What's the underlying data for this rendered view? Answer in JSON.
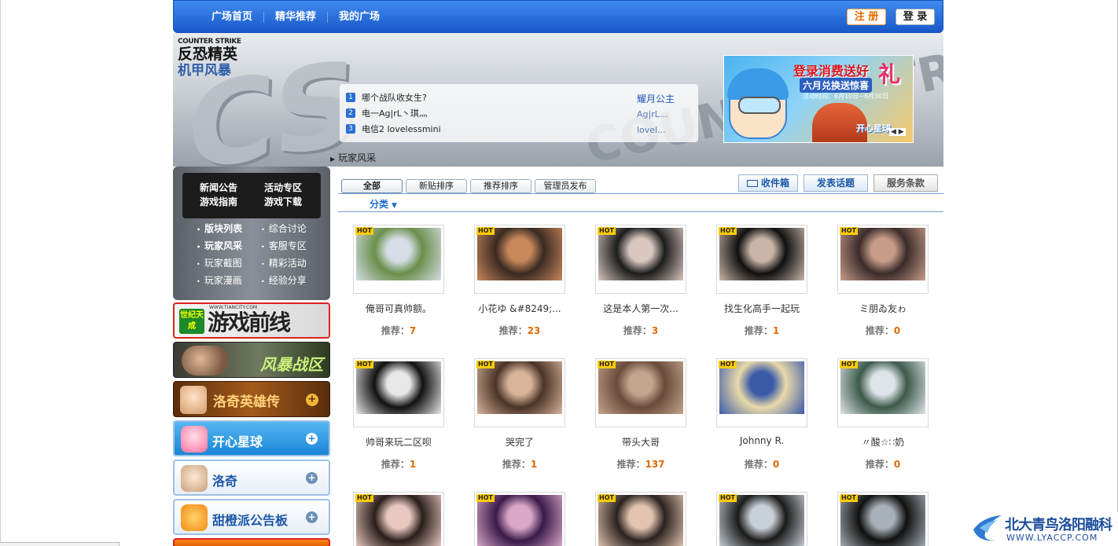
{
  "topnav": {
    "links": [
      "广场首页",
      "精华推荐",
      "我的广场"
    ],
    "register": "注 册",
    "login": "登 录"
  },
  "banner": {
    "bg_text": "CS",
    "bg_text2": "COUNTER-STRIKE",
    "logo_en": "COUNTER STRIKE",
    "logo_cn": "反恐精英",
    "logo_sub": "机甲风暴",
    "notices": [
      {
        "num": "1",
        "text": "哪个战队收女生?"
      },
      {
        "num": "2",
        "text": "电一Ag|rL丶琪灬"
      },
      {
        "num": "3",
        "text": "电信2 lovelessmini"
      }
    ],
    "notice_right": [
      "耀月公主",
      "Ag|rL...",
      "lovel..."
    ],
    "ad": {
      "title": "登录消费送好",
      "li": "礼",
      "sub": "六月兑换送惊喜",
      "date": "活动时间：6月10日~6月30日",
      "brand": "开心星球"
    },
    "crumb": "玩家风采"
  },
  "sidebar": {
    "top_menu": [
      "新闻公告",
      "活动专区",
      "游戏指南",
      "游戏下载"
    ],
    "menu": [
      {
        "label": "版块列表",
        "bold": true
      },
      {
        "label": "综合讨论",
        "bold": false
      },
      {
        "label": "玩家风采",
        "bold": true
      },
      {
        "label": "客服专区",
        "bold": false
      },
      {
        "label": "玩家截图",
        "bold": false
      },
      {
        "label": "精彩活动",
        "bold": false
      },
      {
        "label": "玩家漫画",
        "bold": false
      },
      {
        "label": "经验分享",
        "bold": false
      }
    ],
    "banners": {
      "b1": "游戏前线",
      "b1_badge": "世纪天成",
      "b1_url": "WWW.TIANCITY.COM",
      "b2": "风暴战区",
      "b3": "洛奇英雄传",
      "b4": "开心星球",
      "b5": "洛奇",
      "b6": "甜橙派公告板",
      "plus": "+"
    }
  },
  "main": {
    "tabs": [
      "全部",
      "新贴排序",
      "推荐排序",
      "管理员发布"
    ],
    "actions": {
      "inbox": "收件箱",
      "post": "发表话题",
      "terms": "服务条款"
    },
    "category": "分类",
    "hot_label": "HOT",
    "rec_label": "推荐：",
    "cards": [
      {
        "caption": "俺哥可真帅额。",
        "rec": "7",
        "c1": "#6a8f4a",
        "c2": "#d6dde6"
      },
      {
        "caption": "小花ゆ &#8249;...",
        "rec": "23",
        "c1": "#3a2a22",
        "c2": "#c9885a"
      },
      {
        "caption": "这是本人第一次...",
        "rec": "3",
        "c1": "#1c1c1c",
        "c2": "#d9c8c0"
      },
      {
        "caption": "找生化高手一起玩",
        "rec": "1",
        "c1": "#101010",
        "c2": "#c9b6a8"
      },
      {
        "caption": "ミ朋ゐ友ゎ",
        "rec": "0",
        "c1": "#3b2c2a",
        "c2": "#c79d8a"
      },
      {
        "caption": "帅哥来玩二区呗",
        "rec": "1",
        "c1": "#111111",
        "c2": "#e8e8e8"
      },
      {
        "caption": "哭完了",
        "rec": "1",
        "c1": "#4a3428",
        "c2": "#d8b49a"
      },
      {
        "caption": "带头大哥",
        "rec": "137",
        "c1": "#6a4a3a",
        "c2": "#c3a58e"
      },
      {
        "caption": "Johnny R.",
        "rec": "0",
        "c1": "#e9d9a8",
        "c2": "#3a5aa8"
      },
      {
        "caption": "〃酸☆∷奶",
        "rec": "0",
        "c1": "#3c5a4a",
        "c2": "#dfe4ea"
      },
      {
        "caption": "",
        "rec": "",
        "c1": "#2a1e1a",
        "c2": "#e8c8c0"
      },
      {
        "caption": "",
        "rec": "",
        "c1": "#3a1a4a",
        "c2": "#d9a8c8"
      },
      {
        "caption": "",
        "rec": "",
        "c1": "#2a2220",
        "c2": "#e2c4b0"
      },
      {
        "caption": "",
        "rec": "",
        "c1": "#1a1a1a",
        "c2": "#c8d0d8"
      },
      {
        "caption": "",
        "rec": "",
        "c1": "#101010",
        "c2": "#a8b0b8"
      }
    ]
  },
  "watermark": {
    "cn": "北大青鸟洛阳融科",
    "en": "WWW.LYACCP.COM"
  }
}
